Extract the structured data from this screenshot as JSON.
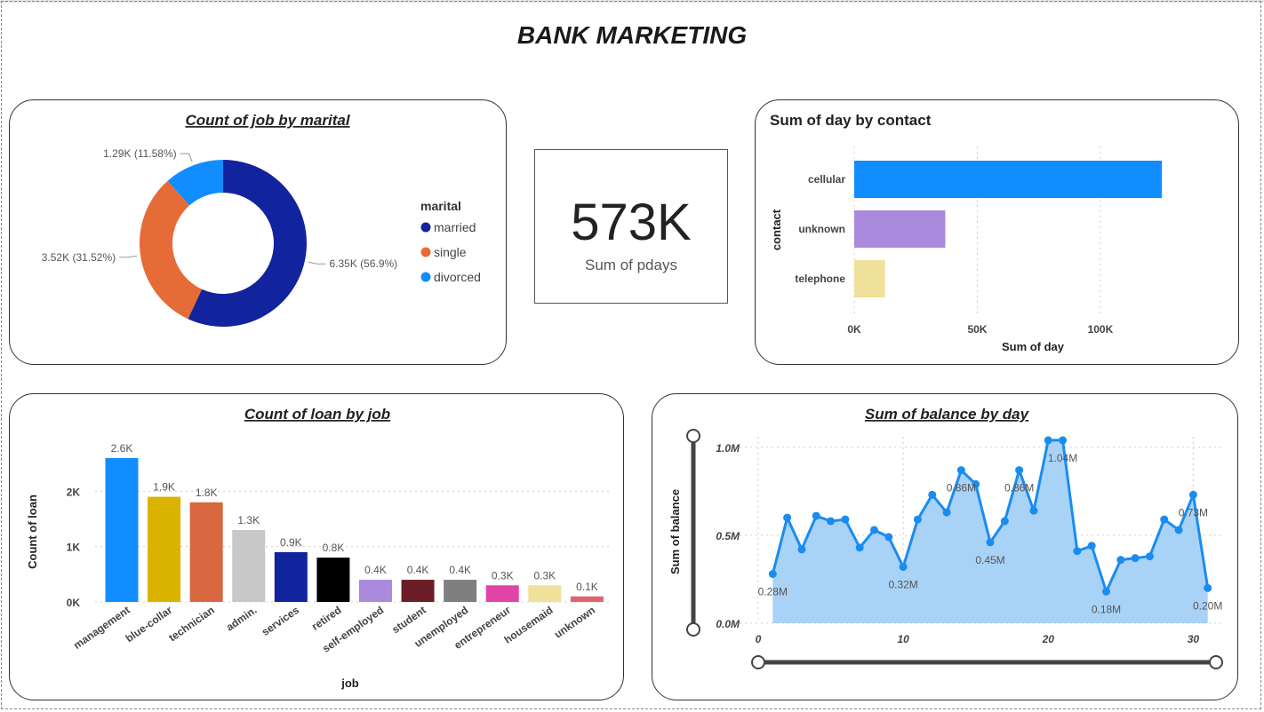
{
  "dashboard": {
    "title": "BANK MARKETING"
  },
  "kpi": {
    "value": "573K",
    "label": "Sum of pdays"
  },
  "colors": {
    "married": "#12239E",
    "single": "#E66C37",
    "divorced": "#118DFF",
    "cellular": "#118DFF",
    "unknown_contact": "#A98ADD",
    "telephone": "#EFE09A",
    "line": "#1A8CF0",
    "area": "#A9D2F7"
  },
  "chart_data": [
    {
      "id": "marital",
      "type": "pie",
      "title": "Count of job by marital",
      "legend_title": "marital",
      "legend_position": "right",
      "slices": [
        {
          "name": "married",
          "value": 6350,
          "label": "6.35K (56.9%)",
          "color": "#12239E"
        },
        {
          "name": "single",
          "value": 3520,
          "label": "3.52K (31.52%)",
          "color": "#E66C37"
        },
        {
          "name": "divorced",
          "value": 1290,
          "label": "1.29K (11.58%)",
          "color": "#118DFF"
        }
      ]
    },
    {
      "id": "contact",
      "type": "bar",
      "orientation": "horizontal",
      "title": "Sum of day by contact",
      "xlabel": "Sum of day",
      "ylabel": "contact",
      "categories": [
        "cellular",
        "unknown",
        "telephone"
      ],
      "values": [
        125000,
        37000,
        12500
      ],
      "colors": [
        "#118DFF",
        "#A98ADD",
        "#EFE09A"
      ],
      "xlim": [
        0,
        130000
      ],
      "xticks": [
        {
          "value": 0,
          "label": "0K"
        },
        {
          "value": 50000,
          "label": "50K"
        },
        {
          "value": 100000,
          "label": "100K"
        }
      ]
    },
    {
      "id": "loan",
      "type": "bar",
      "title": "Count of loan by job",
      "xlabel": "job",
      "ylabel": "Count of loan",
      "categories": [
        "management",
        "blue-collar",
        "technician",
        "admin.",
        "services",
        "retired",
        "self-employed",
        "student",
        "unemployed",
        "entrepreneur",
        "housemaid",
        "unknown"
      ],
      "values": [
        2600,
        1900,
        1800,
        1300,
        900,
        800,
        400,
        400,
        400,
        300,
        300,
        100
      ],
      "value_labels": [
        "2.6K",
        "1.9K",
        "1.8K",
        "1.3K",
        "0.9K",
        "0.8K",
        "0.4K",
        "0.4K",
        "0.4K",
        "0.3K",
        "0.3K",
        "0.1K"
      ],
      "colors": [
        "#118DFF",
        "#D9B300",
        "#D9673F",
        "#C8C8C8",
        "#12239E",
        "#000000",
        "#A98ADD",
        "#6B1E27",
        "#7F7F7F",
        "#E044A7",
        "#EFE09A",
        "#E0646F"
      ],
      "ylim": [
        0,
        3000
      ],
      "yticks": [
        {
          "value": 0,
          "label": "0K"
        },
        {
          "value": 1000,
          "label": "1K"
        },
        {
          "value": 2000,
          "label": "2K"
        }
      ],
      "grid": true
    },
    {
      "id": "balance",
      "type": "area",
      "title": "Sum of balance by day",
      "xlabel": "",
      "ylabel": "Sum of balance",
      "x": [
        1,
        2,
        3,
        4,
        5,
        6,
        7,
        8,
        9,
        10,
        11,
        12,
        13,
        14,
        15,
        16,
        17,
        18,
        19,
        20,
        21,
        22,
        23,
        24,
        25,
        26,
        27,
        28,
        29,
        30,
        31
      ],
      "y": [
        0.28,
        0.6,
        0.42,
        0.61,
        0.58,
        0.59,
        0.43,
        0.53,
        0.49,
        0.32,
        0.59,
        0.73,
        0.63,
        0.87,
        0.79,
        0.46,
        0.58,
        0.87,
        0.64,
        1.04,
        1.04,
        0.41,
        0.44,
        0.18,
        0.36,
        0.37,
        0.38,
        0.59,
        0.53,
        0.73,
        0.2
      ],
      "data_labels": [
        {
          "x": 1,
          "label": "0.28M"
        },
        {
          "x": 10,
          "label": "0.32M"
        },
        {
          "x": 14,
          "label": "0.86M"
        },
        {
          "x": 16,
          "label": "0.45M"
        },
        {
          "x": 18,
          "label": "0.86M"
        },
        {
          "x": 21,
          "label": "1.04M"
        },
        {
          "x": 24,
          "label": "0.18M"
        },
        {
          "x": 30,
          "label": "0.73M"
        },
        {
          "x": 31,
          "label": "0.20M"
        }
      ],
      "xlim": [
        0,
        32
      ],
      "ylim": [
        0,
        1.1
      ],
      "xticks": [
        {
          "value": 0,
          "label": "0"
        },
        {
          "value": 10,
          "label": "10"
        },
        {
          "value": 20,
          "label": "20"
        },
        {
          "value": 30,
          "label": "30"
        }
      ],
      "yticks": [
        {
          "value": 0,
          "label": "0.0M"
        },
        {
          "value": 0.5,
          "label": "0.5M"
        },
        {
          "value": 1.0,
          "label": "1.0M"
        }
      ],
      "grid": true,
      "zoom_sliders": true
    }
  ]
}
